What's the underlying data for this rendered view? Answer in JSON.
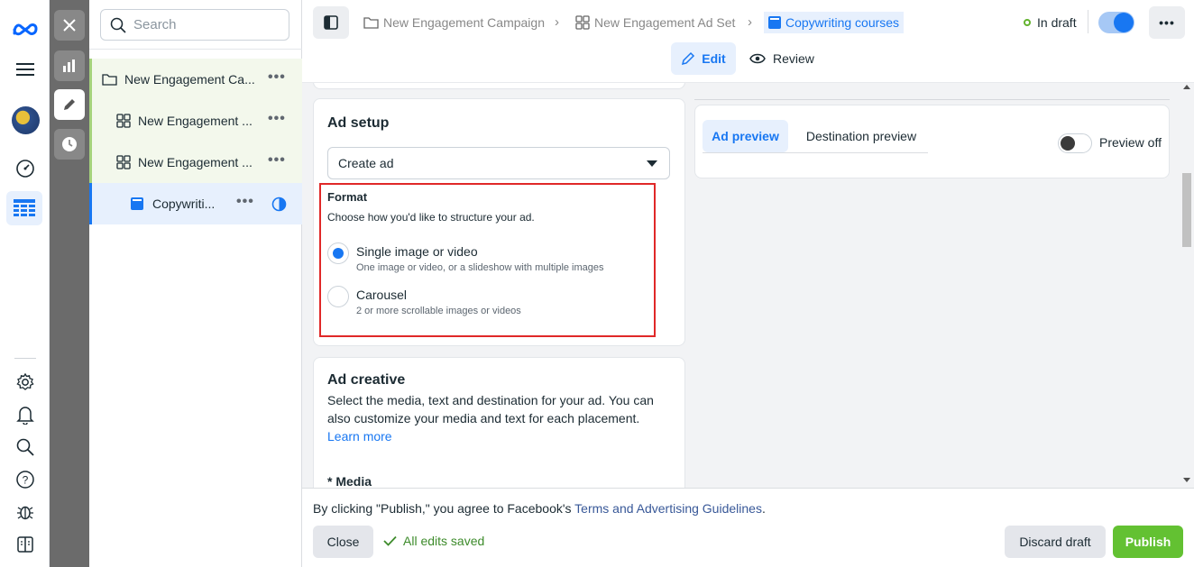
{
  "tree": {
    "search_placeholder": "Search",
    "campaign_label": "New Engagement Ca...",
    "adset1_label": "New Engagement ...",
    "adset2_label": "New Engagement ...",
    "ad_label": "Copywriti..."
  },
  "header": {
    "crumbs": [
      "New Engagement Campaign",
      "New Engagement Ad Set",
      "Copywriting courses"
    ],
    "status": "In draft",
    "tabs": {
      "edit": "Edit",
      "review": "Review"
    }
  },
  "ad_setup": {
    "title": "Ad setup",
    "select_value": "Create ad",
    "format_title": "Format",
    "format_desc": "Choose how you'd like to structure your ad.",
    "options": [
      {
        "label": "Single image or video",
        "desc": "One image or video, or a slideshow with multiple images",
        "selected": true
      },
      {
        "label": "Carousel",
        "desc": "2 or more scrollable images or videos",
        "selected": false
      }
    ]
  },
  "ad_creative": {
    "title": "Ad creative",
    "desc": "Select the media, text and destination for your ad. You can also customize your media and text for each placement.",
    "learn_more": "Learn more",
    "media_label": "* Media"
  },
  "preview": {
    "tab_ad": "Ad preview",
    "tab_dest": "Destination preview",
    "toggle_label": "Preview off"
  },
  "footer": {
    "notice_prefix": "By clicking \"Publish,\" you agree to Facebook's ",
    "notice_link": "Terms and Advertising Guidelines",
    "notice_suffix": ".",
    "close": "Close",
    "saved": "All edits saved",
    "discard": "Discard draft",
    "publish": "Publish"
  },
  "colors": {
    "accent": "#1877f2",
    "publish": "#63c132",
    "highlight": "#e02828",
    "saved": "#3d8b2b"
  }
}
